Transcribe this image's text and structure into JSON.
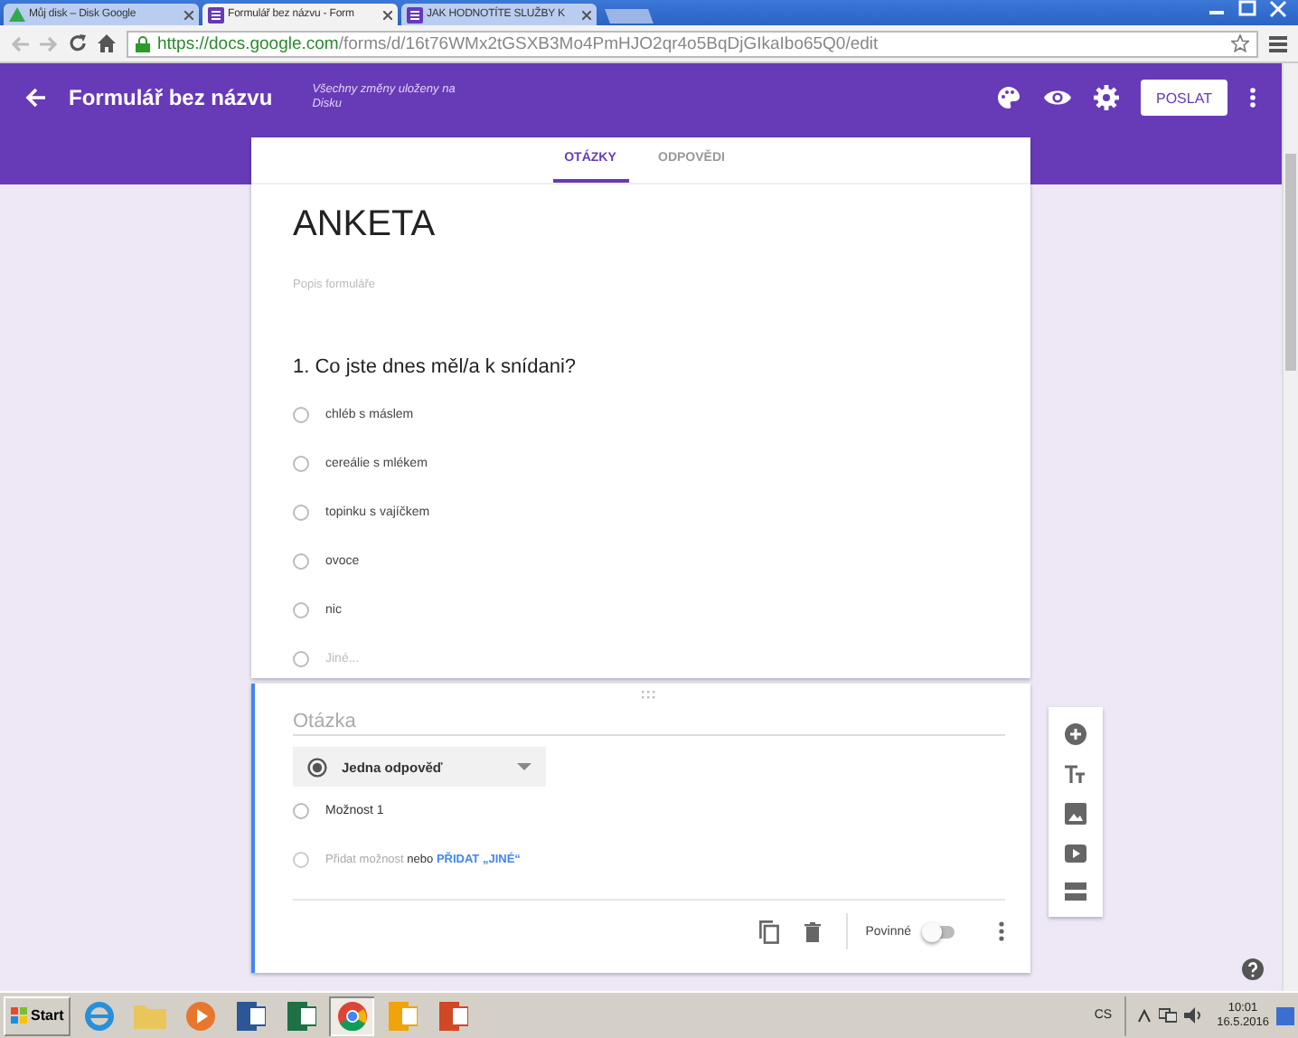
{
  "browser": {
    "tabs": [
      {
        "title": "Můj disk – Disk Google",
        "kind": "drive",
        "selected": false
      },
      {
        "title": "Formulář bez názvu - Form",
        "kind": "forms",
        "selected": true
      },
      {
        "title": "JAK HODNOTÍTE SLUŽBY K",
        "kind": "forms",
        "selected": false
      }
    ],
    "url_host": "https://docs.google.com",
    "url_path": "/forms/d/16t76WMx2tGSXB3Mo4PmHJO2qr4o5BqDjGIkaIbo65Q0/edit"
  },
  "header": {
    "title": "Formulář bez názvu",
    "save_status": "Všechny změny uloženy na Disku",
    "send_button": "POSLAT"
  },
  "form_tabs": [
    {
      "label": "OTÁZKY",
      "selected": true
    },
    {
      "label": "ODPOVĚDI",
      "selected": false
    }
  ],
  "form": {
    "title": "ANKETA",
    "description_placeholder": "Popis formuláře"
  },
  "question": {
    "title": "1. Co jste dnes měl/a k snídani?",
    "options": [
      {
        "label": "chléb s máslem",
        "kind": "option",
        "selected": false
      },
      {
        "label": "cereálie s mlékem",
        "kind": "option",
        "selected": false
      },
      {
        "label": "topinku s vajíčkem",
        "kind": "option",
        "selected": false
      },
      {
        "label": "ovoce",
        "kind": "option",
        "selected": false
      },
      {
        "label": "nic",
        "kind": "option",
        "selected": false
      },
      {
        "label": "Jiné...",
        "kind": "other",
        "selected": false
      }
    ]
  },
  "new_question": {
    "title_placeholder": "Otázka",
    "type": "Jedna odpověď",
    "options": [
      {
        "label": "Možnost 1",
        "selected": false
      }
    ],
    "add_option": "Přidat možnost",
    "or": "nebo",
    "add_other": "PŘIDAT „JINÉ“",
    "required_label": "Povinné",
    "required": false
  },
  "taskbar": {
    "start": "Start",
    "apps": [
      {
        "kind": "ie",
        "selected": false
      },
      {
        "kind": "folder",
        "selected": false
      },
      {
        "kind": "media",
        "selected": false
      },
      {
        "kind": "word",
        "selected": false
      },
      {
        "kind": "excel",
        "selected": false
      },
      {
        "kind": "chrome",
        "selected": true
      },
      {
        "kind": "outlook",
        "selected": false
      },
      {
        "kind": "powerpoint",
        "selected": false
      }
    ],
    "language": "CS",
    "time": "10:01",
    "date": "16.5.2016"
  }
}
